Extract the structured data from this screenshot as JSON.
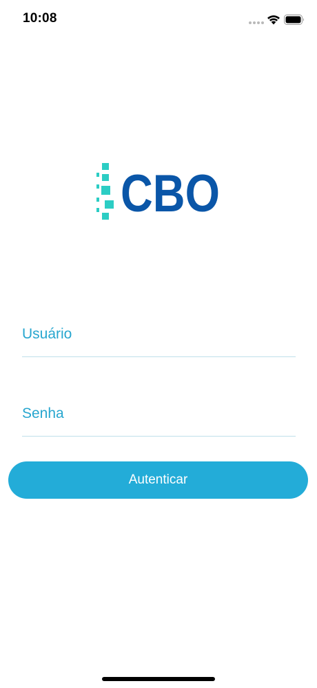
{
  "status_bar": {
    "time": "10:08",
    "icons": [
      "signal-icon",
      "wifi-icon",
      "battery-icon"
    ]
  },
  "logo": {
    "text": "CBO",
    "text_color": "#0a56a8",
    "mark_color": "#2ccdc4"
  },
  "form": {
    "username_placeholder": "Usuário",
    "password_placeholder": "Senha",
    "submit_label": "Autenticar"
  },
  "colors": {
    "accent": "#23acd8",
    "label": "#27a6cf",
    "underline": "#bfe0ea"
  }
}
